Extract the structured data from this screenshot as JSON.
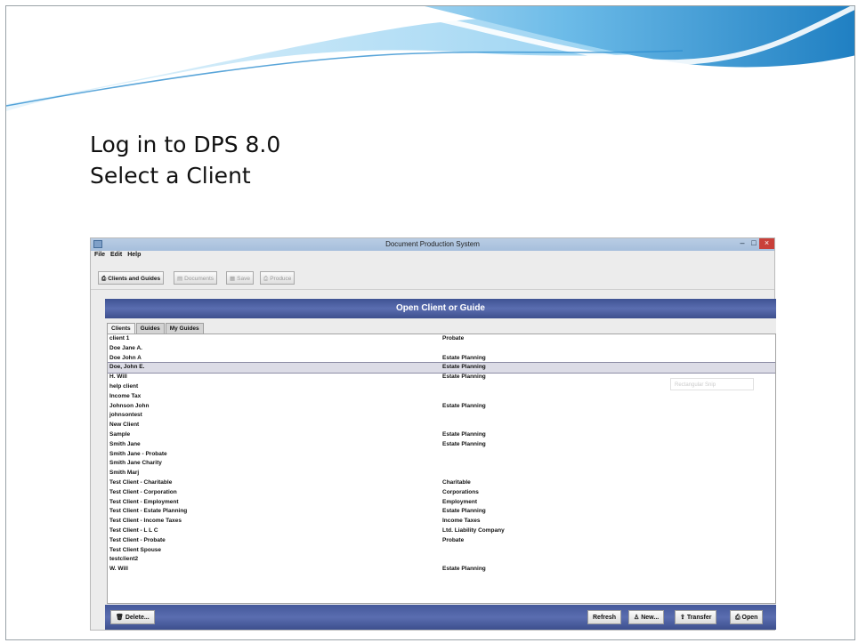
{
  "slide": {
    "title_line1": "Log in to DPS 8.0",
    "title_line2": "Select a Client"
  },
  "window": {
    "title": "Document Production System",
    "controls": {
      "minimize": "–",
      "maximize": "□",
      "close": "×"
    }
  },
  "menu": [
    "File",
    "Edit",
    "Help"
  ],
  "toolbar": [
    {
      "label": "Clients and Guides",
      "icon": "clients-icon",
      "enabled": true
    },
    {
      "label": "Documents",
      "icon": "documents-icon",
      "enabled": false
    },
    {
      "label": "Save",
      "icon": "save-icon",
      "enabled": false
    },
    {
      "label": "Produce",
      "icon": "produce-icon",
      "enabled": false
    }
  ],
  "panel": {
    "title": "Open Client or Guide",
    "tabs": [
      "Clients",
      "Guides",
      "My Guides"
    ],
    "active_tab": "Clients"
  },
  "clients": [
    {
      "name": "client 1",
      "type": "Probate"
    },
    {
      "name": "Doe Jane A.",
      "type": ""
    },
    {
      "name": "Doe John A",
      "type": "Estate Planning"
    },
    {
      "name": "Doe, John E.",
      "type": "Estate Planning",
      "selected": true
    },
    {
      "name": "H. Will",
      "type": "Estate Planning"
    },
    {
      "name": "help client",
      "type": ""
    },
    {
      "name": "Income Tax",
      "type": ""
    },
    {
      "name": "Johnson John",
      "type": "Estate Planning"
    },
    {
      "name": "johnsontest",
      "type": ""
    },
    {
      "name": "New Client",
      "type": ""
    },
    {
      "name": "Sample",
      "type": "Estate Planning"
    },
    {
      "name": "Smith Jane",
      "type": "Estate Planning"
    },
    {
      "name": "Smith Jane - Probate",
      "type": ""
    },
    {
      "name": "Smith Jane Charity",
      "type": ""
    },
    {
      "name": "Smith Marj",
      "type": ""
    },
    {
      "name": "Test Client - Charitable",
      "type": "Charitable"
    },
    {
      "name": "Test Client - Corporation",
      "type": "Corporations"
    },
    {
      "name": "Test Client - Employment",
      "type": "Employment"
    },
    {
      "name": "Test Client - Estate Planning",
      "type": "Estate Planning"
    },
    {
      "name": "Test Client - Income Taxes",
      "type": "Income Taxes"
    },
    {
      "name": "Test Client - L L C",
      "type": "Ltd. Liability Company"
    },
    {
      "name": "Test Client - Probate",
      "type": "Probate"
    },
    {
      "name": "Test Client Spouse",
      "type": ""
    },
    {
      "name": "testclient2",
      "type": ""
    },
    {
      "name": "W. Will",
      "type": "Estate Planning"
    }
  ],
  "ghost_button": "Rectangular Snip",
  "actions": {
    "delete": "Delete...",
    "refresh": "Refresh",
    "new": "New...",
    "transfer": "Transfer",
    "open": "Open"
  },
  "colors": {
    "panel_header": "#4a5ea2",
    "banner_blue": "#2a8fd0",
    "banner_light": "#9fd4f3",
    "selected_row": "#dcdce6"
  }
}
